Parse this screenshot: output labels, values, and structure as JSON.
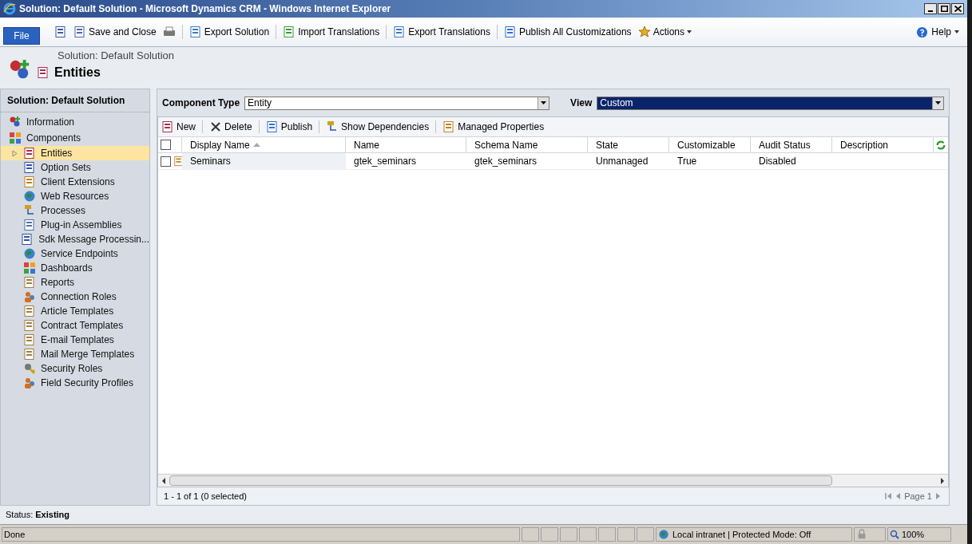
{
  "window": {
    "title": "Solution: Default Solution - Microsoft Dynamics CRM - Windows Internet Explorer"
  },
  "ribbon": {
    "file_tab": "File",
    "commands": [
      {
        "kind": "icon"
      },
      {
        "kind": "command",
        "label": "Save and Close"
      },
      {
        "kind": "icon"
      },
      {
        "kind": "separator"
      },
      {
        "kind": "command",
        "label": "Export Solution"
      },
      {
        "kind": "separator"
      },
      {
        "kind": "command",
        "label": "Import Translations"
      },
      {
        "kind": "separator"
      },
      {
        "kind": "command",
        "label": "Export Translations"
      },
      {
        "kind": "separator"
      },
      {
        "kind": "command",
        "label": "Publish All Customizations"
      },
      {
        "kind": "menu",
        "label": "Actions"
      }
    ],
    "help": "Help"
  },
  "header": {
    "breadcrumb": "Solution: Default Solution",
    "title": "Entities"
  },
  "sidebar": {
    "title": "Solution: Default Solution",
    "items": [
      {
        "label": "Information",
        "selected": false
      },
      {
        "label": "Components",
        "selected": false,
        "children": [
          {
            "label": "Entities",
            "kind": "expandable",
            "selected": true
          },
          {
            "label": "Option Sets",
            "kind": "leaf",
            "selected": false
          },
          {
            "label": "Client Extensions",
            "kind": "leaf",
            "selected": false
          },
          {
            "label": "Web Resources",
            "kind": "leaf",
            "selected": false
          },
          {
            "label": "Processes",
            "kind": "leaf",
            "selected": false
          },
          {
            "label": "Plug-in Assemblies",
            "kind": "leaf",
            "selected": false
          },
          {
            "label": "Sdk Message Processin...",
            "kind": "leaf",
            "selected": false
          },
          {
            "label": "Service Endpoints",
            "kind": "leaf",
            "selected": false
          },
          {
            "label": "Dashboards",
            "kind": "leaf",
            "selected": false
          },
          {
            "label": "Reports",
            "kind": "leaf",
            "selected": false
          },
          {
            "label": "Connection Roles",
            "kind": "leaf",
            "selected": false
          },
          {
            "label": "Article Templates",
            "kind": "leaf",
            "selected": false
          },
          {
            "label": "Contract Templates",
            "kind": "leaf",
            "selected": false
          },
          {
            "label": "E-mail Templates",
            "kind": "leaf",
            "selected": false
          },
          {
            "label": "Mail Merge Templates",
            "kind": "leaf",
            "selected": false
          },
          {
            "label": "Security Roles",
            "kind": "leaf",
            "selected": false
          },
          {
            "label": "Field Security Profiles",
            "kind": "leaf",
            "selected": false
          }
        ]
      }
    ]
  },
  "filters": {
    "component_type_label": "Component Type",
    "component_type": "Entity",
    "view_label": "View",
    "view": "Custom"
  },
  "grid_toolbar": [
    "New",
    "Delete",
    "Publish",
    "Show Dependencies",
    "Managed Properties"
  ],
  "table": {
    "select_all_checked": false,
    "columns": [
      {
        "label": "Display Name",
        "sorted": true
      },
      {
        "label": "Name",
        "sorted": false
      },
      {
        "label": "Schema Name",
        "sorted": false
      },
      {
        "label": "State",
        "sorted": false
      },
      {
        "label": "Customizable",
        "sorted": false
      },
      {
        "label": "Audit Status",
        "sorted": false
      },
      {
        "label": "Description",
        "sorted": false
      }
    ],
    "rows": [
      {
        "checked": false,
        "cells": [
          "Seminars",
          "gtek_seminars",
          "gtek_seminars",
          "Unmanaged",
          "True",
          "Disabled",
          null
        ]
      }
    ]
  },
  "footer": {
    "count": "1 - 1 of 1 (0 selected)",
    "page": "Page 1"
  },
  "status": {
    "label": "Status:",
    "value": "Existing"
  },
  "ie_status": {
    "text": "Done",
    "zone": "Local intranet | Protected Mode: Off",
    "zoom": "100%"
  }
}
